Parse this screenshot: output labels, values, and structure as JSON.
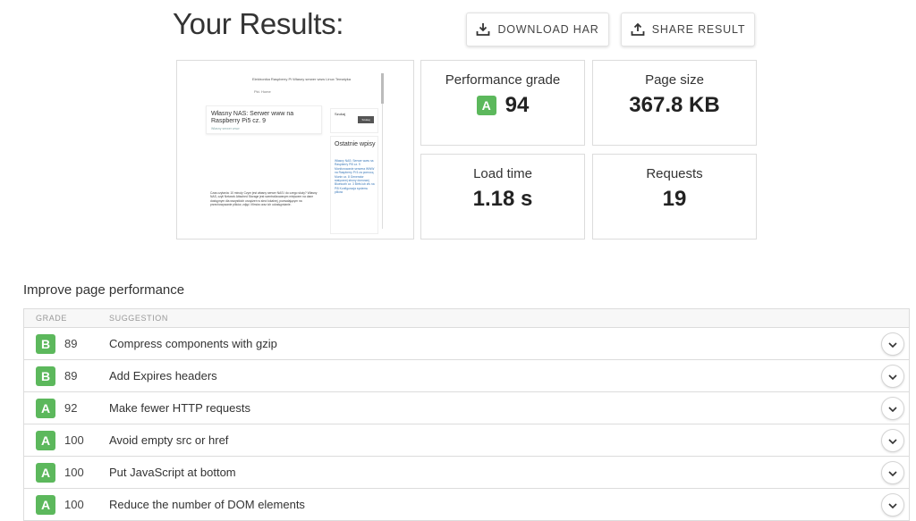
{
  "header": {
    "title": "Your Results:",
    "download_har_label": "DOWNLOAD HAR",
    "share_result_label": "SHARE RESULT"
  },
  "screenshot_preview": {
    "nav": "Elektronika     Raspberry Pi     Własny serwer www     Linux     Tematyka",
    "crumb": "Pkt.     Home",
    "post_title": "Własny NAS: Serwer www na Raspberry Pi5 cz. 9",
    "post_meta": "Własny serwer www",
    "search_label": "Szukaj",
    "search_button": "Szukaj",
    "sidebar_title": "Ostatnie wpisy",
    "sidebar_links": "Własny NAS: Serwer www na Raspberry Pi5 cz. 9 Monitorowanie serwera WWW na Raspberry Pi 5 za pomocą Munin cz. 8 Generator statycznej strony domowej Bluetooth cz. 3 Btrfs lub zfs na Pi5 Konfiguracja systemu plików",
    "body_text": "Czas czytania: 10 minuty Czym jest własny serwer NAS i do czego służy? Własny NAS, czyli Network Attached Storage jest scentralizowanym miejscem na dane dostępnym dla wszystkich urządzeń w sieci lokalnej, pozwalającym na przechowywanie plików, zdjęć i filmów oraz ich udostępnianie."
  },
  "metrics": {
    "performance_grade": {
      "label": "Performance grade",
      "letter": "A",
      "value": "94"
    },
    "page_size": {
      "label": "Page size",
      "value": "367.8 KB"
    },
    "load_time": {
      "label": "Load time",
      "value": "1.18 s"
    },
    "requests": {
      "label": "Requests",
      "value": "19"
    }
  },
  "improve": {
    "title": "Improve page performance",
    "columns": {
      "grade": "GRADE",
      "suggestion": "SUGGESTION"
    },
    "rows": [
      {
        "letter": "B",
        "score": "89",
        "suggestion": "Compress components with gzip"
      },
      {
        "letter": "B",
        "score": "89",
        "suggestion": "Add Expires headers"
      },
      {
        "letter": "A",
        "score": "92",
        "suggestion": "Make fewer HTTP requests"
      },
      {
        "letter": "A",
        "score": "100",
        "suggestion": "Avoid empty src or href"
      },
      {
        "letter": "A",
        "score": "100",
        "suggestion": "Put JavaScript at bottom"
      },
      {
        "letter": "A",
        "score": "100",
        "suggestion": "Reduce the number of DOM elements"
      }
    ]
  },
  "colors": {
    "grade_green": "#5cb85c"
  },
  "icons": {
    "download": "download-icon",
    "share": "share-icon",
    "expand": "chevron-down-icon"
  }
}
